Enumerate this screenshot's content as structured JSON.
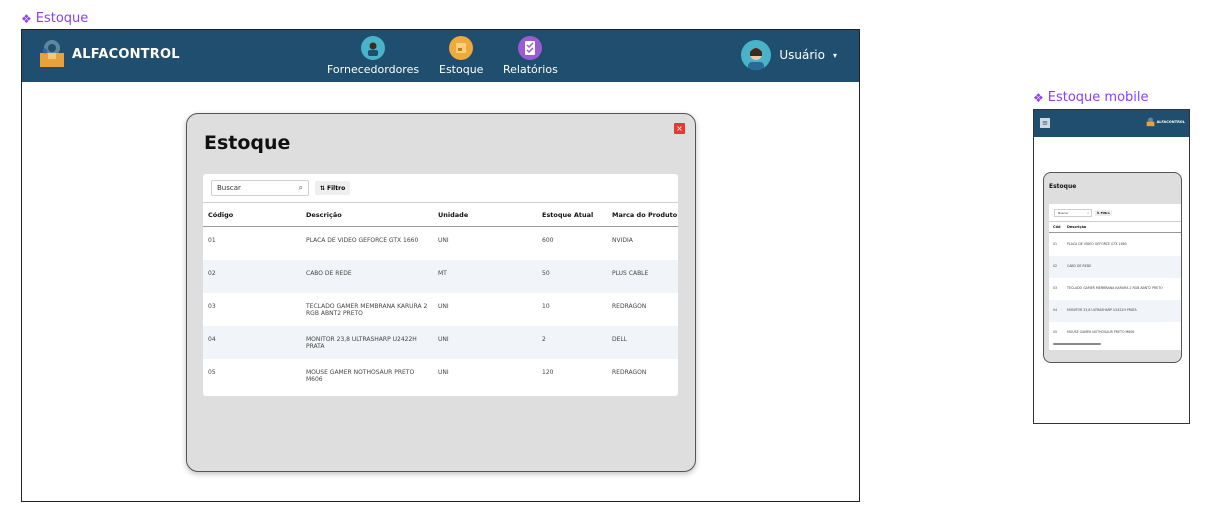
{
  "desktop_label": "Estoque",
  "mobile_label": "Estoque mobile",
  "brand": {
    "name": "ALFACONTROL"
  },
  "nav": [
    {
      "label": "Fornecedordores",
      "icon": "supplier-icon"
    },
    {
      "label": "Estoque",
      "icon": "box-icon"
    },
    {
      "label": "Relatórios",
      "icon": "report-icon"
    }
  ],
  "user": {
    "name": "Usuário",
    "caret": "▾"
  },
  "modal": {
    "title": "Estoque",
    "close": "×",
    "search_placeholder": "Buscar",
    "filter_label": "Filtro",
    "columns": [
      "Código",
      "Descrição",
      "Unidade",
      "Estoque Atual",
      "Marca do Produto"
    ],
    "rows": [
      [
        "01",
        "PLACA DE VIDEO GEFORCE GTX 1660",
        "UNI",
        "600",
        "NVIDIA"
      ],
      [
        "02",
        "CABO DE REDE",
        "MT",
        "50",
        "PLUS CABLE"
      ],
      [
        "03",
        "TECLADO GAMER MEMBRANA KARURA 2 RGB ABNT2 PRETO",
        "UNI",
        "10",
        "REDRAGON"
      ],
      [
        "04",
        "MONITOR 23,8 ULTRASHARP U2422H PRATA",
        "UNI",
        "2",
        "DELL"
      ],
      [
        "05",
        "MOUSE GAMER NOTHOSAUR PRETO M606",
        "UNI",
        "120",
        "REDRAGON"
      ]
    ]
  },
  "mobile": {
    "brand": "ALFACONTROL",
    "title": "Estoque",
    "search_placeholder": "Buscar",
    "filter_label": "Filtro",
    "columns": [
      "Cód",
      "Descrição"
    ],
    "rows": [
      [
        "01",
        "PLACA DE VIDEO GEFORCE GTX 1660"
      ],
      [
        "02",
        "CABO DE REDE"
      ],
      [
        "03",
        "TECLADO GAMER MEMBRANA KARURA 2 RGB ABNT2 PRETO"
      ],
      [
        "04",
        "MONITOR 23,8 ULTRASHARP U2422H PRATA"
      ],
      [
        "05",
        "MOUSE GAMER NOTHOSAUR PRETO M606"
      ]
    ]
  },
  "colors": {
    "topbar": "#1f4e6e",
    "accent_label": "#8a3ffc",
    "close": "#e53935"
  }
}
